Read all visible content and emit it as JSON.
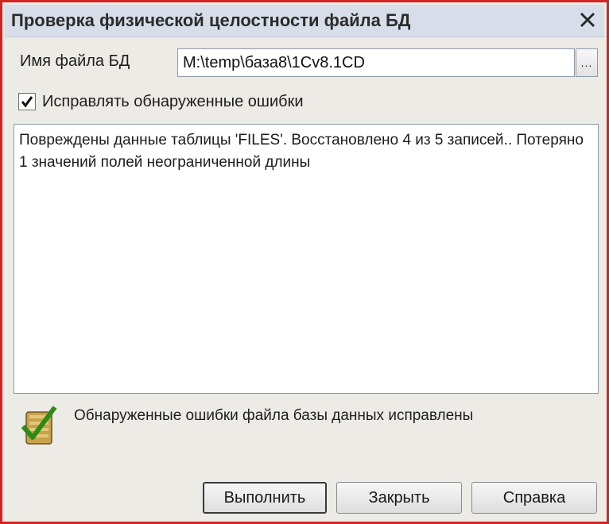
{
  "window": {
    "title": "Проверка физической целостности файла БД",
    "close_glyph": "✕"
  },
  "file_field": {
    "label": "Имя файла БД",
    "value": "M:\\temp\\база8\\1Cv8.1CD",
    "browse_label": "..."
  },
  "fix_errors": {
    "checked": true,
    "label": "Исправлять обнаруженные ошибки"
  },
  "log": {
    "text": "Повреждены данные таблицы 'FILES'. Восстановлено 4 из 5 записей.. Потеряно 1 значений полей неограниченной длины"
  },
  "status": {
    "icon": "database-check-icon",
    "message": "Обнаруженные ошибки файла базы данных исправлены"
  },
  "buttons": {
    "run": "Выполнить",
    "close": "Закрыть",
    "help": "Справка"
  },
  "colors": {
    "title_bar": "#d7dee9",
    "dialog_bg": "#ecebe6",
    "outer_border": "#d42222"
  }
}
